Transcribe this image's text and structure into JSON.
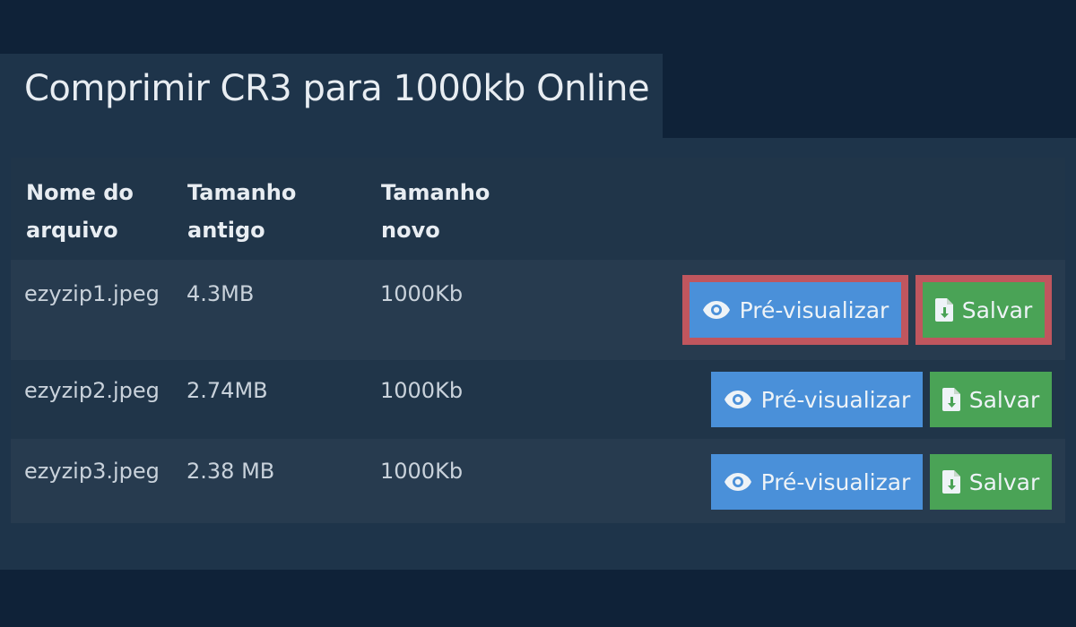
{
  "page": {
    "title": "Comprimir CR3 para 1000kb Online"
  },
  "table": {
    "headers": {
      "filename": "Nome do arquivo",
      "old_size": "Tamanho antigo",
      "new_size": "Tamanho novo"
    },
    "rows": [
      {
        "filename": "ezyzip1.jpeg",
        "old_size": "4.3MB",
        "new_size": "1000Kb",
        "preview_label": "Pré-visualizar",
        "save_label": "Salvar"
      },
      {
        "filename": "ezyzip2.jpeg",
        "old_size": "2.74MB",
        "new_size": "1000Kb",
        "preview_label": "Pré-visualizar",
        "save_label": "Salvar"
      },
      {
        "filename": "ezyzip3.jpeg",
        "old_size": "2.38 MB",
        "new_size": "1000Kb",
        "preview_label": "Pré-visualizar",
        "save_label": "Salvar"
      }
    ]
  },
  "icons": {
    "preview": "eye-icon",
    "save": "file-download-icon"
  },
  "colors": {
    "background": "#0f2238",
    "panel": "#1e344a",
    "preview_button": "#4a90d9",
    "save_button": "#4aa356",
    "highlight": "#c0565e"
  }
}
